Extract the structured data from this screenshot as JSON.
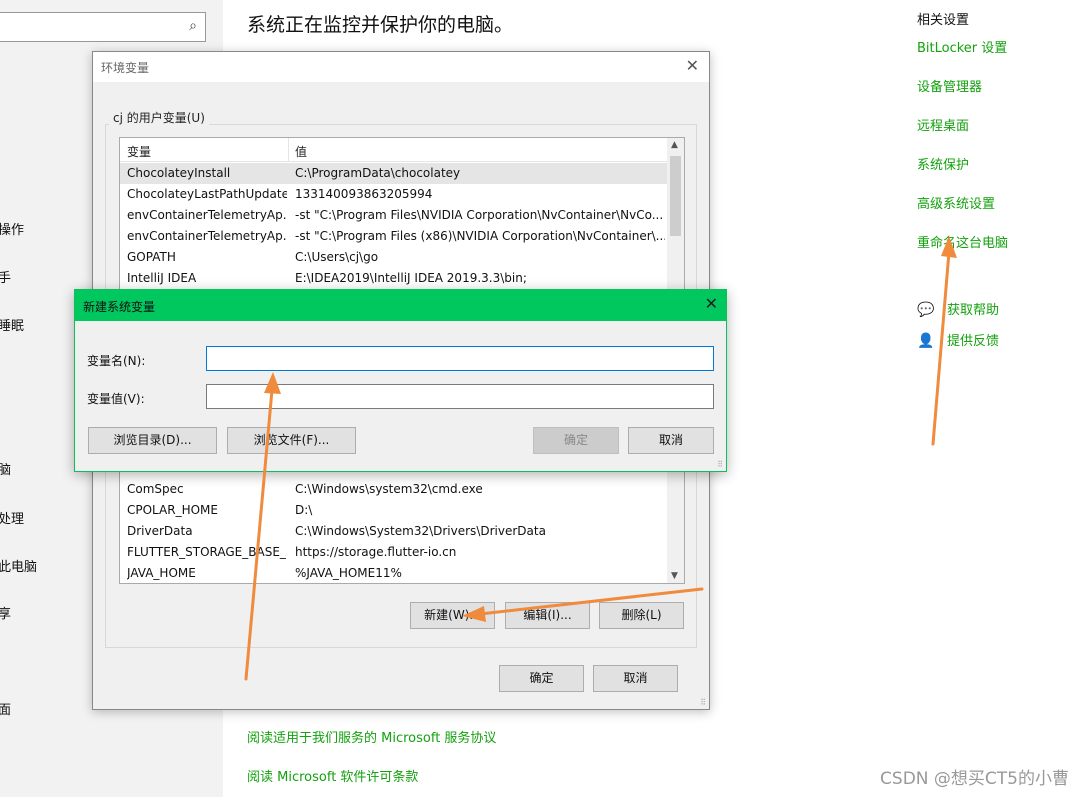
{
  "leftnav": {
    "items": [
      "操作",
      "手",
      "睡眠",
      "脑",
      "处理",
      "此电脑",
      "享",
      "面"
    ]
  },
  "main": {
    "headline": "系统正在监控并保护你的电脑。",
    "links": [
      "阅读适用于我们服务的 Microsoft 服务协议",
      "阅读 Microsoft 软件许可条款"
    ]
  },
  "related": {
    "title": "相关设置",
    "links": [
      "BitLocker 设置",
      "设备管理器",
      "远程桌面",
      "系统保护",
      "高级系统设置",
      "重命名这台电脑"
    ],
    "help": "获取帮助",
    "feedback": "提供反馈"
  },
  "env_dialog": {
    "title": "环境变量",
    "user_group": "cj 的用户变量(U)",
    "columns": [
      "变量",
      "值"
    ],
    "rows_top": [
      {
        "name": "ChocolateyInstall",
        "value": "C:\\ProgramData\\chocolatey"
      },
      {
        "name": "ChocolateyLastPathUpdate",
        "value": "133140093863205994"
      },
      {
        "name": "envContainerTelemetryAp...",
        "value": "-st \"C:\\Program Files\\NVIDIA Corporation\\NvContainer\\NvCo..."
      },
      {
        "name": "envContainerTelemetryAp...",
        "value": "-st \"C:\\Program Files (x86)\\NVIDIA Corporation\\NvContainer\\..."
      },
      {
        "name": "GOPATH",
        "value": "C:\\Users\\cj\\go"
      },
      {
        "name": "IntelliJ IDEA",
        "value": "E:\\IDEA2019\\IntelliJ IDEA 2019.3.3\\bin;"
      }
    ],
    "rows_bottom": [
      {
        "name": "ComSpec",
        "value": "C:\\Windows\\system32\\cmd.exe"
      },
      {
        "name": "CPOLAR_HOME",
        "value": "D:\\"
      },
      {
        "name": "DriverData",
        "value": "C:\\Windows\\System32\\Drivers\\DriverData"
      },
      {
        "name": "FLUTTER_STORAGE_BASE_...",
        "value": "https://storage.flutter-io.cn"
      },
      {
        "name": "JAVA_HOME",
        "value": "%JAVA_HOME11%"
      }
    ],
    "buttons": {
      "new": "新建(W)...",
      "edit": "编辑(I)...",
      "delete": "删除(L)",
      "ok": "确定",
      "cancel": "取消"
    }
  },
  "new_dialog": {
    "title": "新建系统变量",
    "name_label": "变量名(N):",
    "value_label": "变量值(V):",
    "name_value": "",
    "value_value": "",
    "buttons": {
      "browse_dir": "浏览目录(D)...",
      "browse_file": "浏览文件(F)...",
      "ok": "确定",
      "cancel": "取消"
    }
  },
  "annotation_color": "#f08a3c",
  "accent_green": "#00c85f",
  "watermark": "CSDN @想买CT5的小曹"
}
